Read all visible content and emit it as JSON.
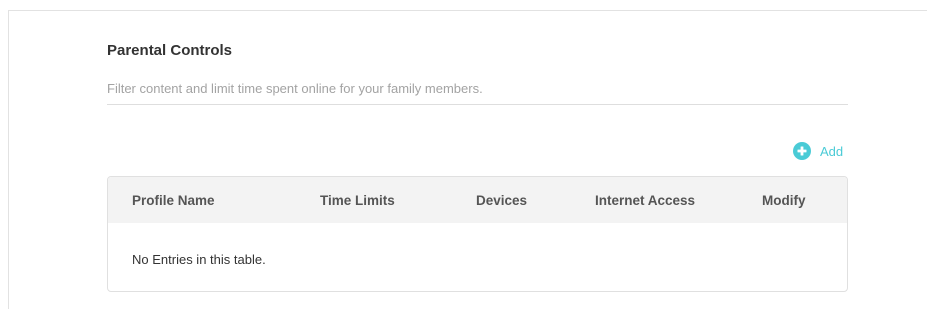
{
  "section": {
    "title": "Parental Controls",
    "description": "Filter content and limit time spent online for your family members."
  },
  "toolbar": {
    "add_label": "Add",
    "add_icon": "plus-circle-icon",
    "accent_color": "#4acbd6"
  },
  "table": {
    "columns": [
      "Profile Name",
      "Time Limits",
      "Devices",
      "Internet Access",
      "Modify"
    ],
    "empty_text": "No Entries in this table."
  }
}
